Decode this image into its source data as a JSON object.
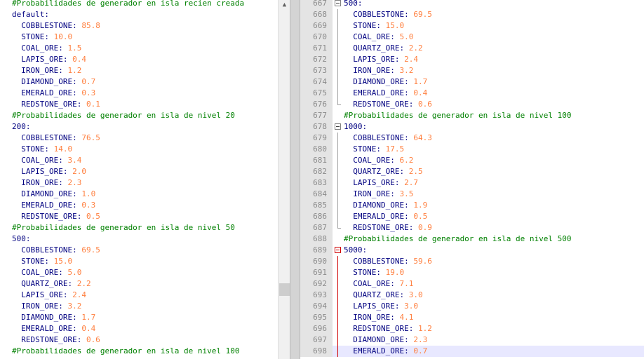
{
  "left_lines": [
    {
      "type": "comment",
      "text": "#Probabilidades de generador en isla recien creada"
    },
    {
      "type": "header",
      "text": "default:"
    },
    {
      "type": "entry",
      "key": "COBBLESTONE",
      "value": "85.8"
    },
    {
      "type": "entry",
      "key": "STONE",
      "value": "10.0"
    },
    {
      "type": "entry",
      "key": "COAL_ORE",
      "value": "1.5"
    },
    {
      "type": "entry",
      "key": "LAPIS_ORE",
      "value": "0.4"
    },
    {
      "type": "entry",
      "key": "IRON_ORE",
      "value": "1.2"
    },
    {
      "type": "entry",
      "key": "DIAMOND_ORE",
      "value": "0.7"
    },
    {
      "type": "entry",
      "key": "EMERALD_ORE",
      "value": "0.3"
    },
    {
      "type": "entry",
      "key": "REDSTONE_ORE",
      "value": "0.1"
    },
    {
      "type": "comment",
      "text": "#Probabilidades de generador en isla de nivel 20"
    },
    {
      "type": "header",
      "text": "200:"
    },
    {
      "type": "entry",
      "key": "COBBLESTONE",
      "value": "76.5"
    },
    {
      "type": "entry",
      "key": "STONE",
      "value": "14.0"
    },
    {
      "type": "entry",
      "key": "COAL_ORE",
      "value": "3.4"
    },
    {
      "type": "entry",
      "key": "LAPIS_ORE",
      "value": "2.0"
    },
    {
      "type": "entry",
      "key": "IRON_ORE",
      "value": "2.3"
    },
    {
      "type": "entry",
      "key": "DIAMOND_ORE",
      "value": "1.0"
    },
    {
      "type": "entry",
      "key": "EMERALD_ORE",
      "value": "0.3"
    },
    {
      "type": "entry",
      "key": "REDSTONE_ORE",
      "value": "0.5"
    },
    {
      "type": "comment",
      "text": "#Probabilidades de generador en isla de nivel 50"
    },
    {
      "type": "header",
      "text": "500:"
    },
    {
      "type": "entry",
      "key": "COBBLESTONE",
      "value": "69.5"
    },
    {
      "type": "entry",
      "key": "STONE",
      "value": "15.0"
    },
    {
      "type": "entry",
      "key": "COAL_ORE",
      "value": "5.0"
    },
    {
      "type": "entry",
      "key": "QUARTZ_ORE",
      "value": "2.2"
    },
    {
      "type": "entry",
      "key": "LAPIS_ORE",
      "value": "2.4"
    },
    {
      "type": "entry",
      "key": "IRON_ORE",
      "value": "3.2"
    },
    {
      "type": "entry",
      "key": "DIAMOND_ORE",
      "value": "1.7"
    },
    {
      "type": "entry",
      "key": "EMERALD_ORE",
      "value": "0.4"
    },
    {
      "type": "entry",
      "key": "REDSTONE_ORE",
      "value": "0.6"
    },
    {
      "type": "comment",
      "text": "#Probabilidades de generador en isla de nivel 100"
    }
  ],
  "right_lines": [
    {
      "ln": "667",
      "type": "header",
      "text": "500:",
      "fold": "open"
    },
    {
      "ln": "668",
      "type": "entry",
      "key": "COBBLESTONE",
      "value": "69.5",
      "fold": "line"
    },
    {
      "ln": "669",
      "type": "entry",
      "key": "STONE",
      "value": "15.0",
      "fold": "line"
    },
    {
      "ln": "670",
      "type": "entry",
      "key": "COAL_ORE",
      "value": "5.0",
      "fold": "line"
    },
    {
      "ln": "671",
      "type": "entry",
      "key": "QUARTZ_ORE",
      "value": "2.2",
      "fold": "line"
    },
    {
      "ln": "672",
      "type": "entry",
      "key": "LAPIS_ORE",
      "value": "2.4",
      "fold": "line"
    },
    {
      "ln": "673",
      "type": "entry",
      "key": "IRON_ORE",
      "value": "3.2",
      "fold": "line"
    },
    {
      "ln": "674",
      "type": "entry",
      "key": "DIAMOND_ORE",
      "value": "1.7",
      "fold": "line"
    },
    {
      "ln": "675",
      "type": "entry",
      "key": "EMERALD_ORE",
      "value": "0.4",
      "fold": "line"
    },
    {
      "ln": "676",
      "type": "entry",
      "key": "REDSTONE_ORE",
      "value": "0.6",
      "fold": "end"
    },
    {
      "ln": "677",
      "type": "comment",
      "text": "#Probabilidades de generador en isla de nivel 100",
      "fold": ""
    },
    {
      "ln": "678",
      "type": "header",
      "text": "1000:",
      "fold": "open"
    },
    {
      "ln": "679",
      "type": "entry",
      "key": "COBBLESTONE",
      "value": "64.3",
      "fold": "line"
    },
    {
      "ln": "680",
      "type": "entry",
      "key": "STONE",
      "value": "17.5",
      "fold": "line"
    },
    {
      "ln": "681",
      "type": "entry",
      "key": "COAL_ORE",
      "value": "6.2",
      "fold": "line"
    },
    {
      "ln": "682",
      "type": "entry",
      "key": "QUARTZ_ORE",
      "value": "2.5",
      "fold": "line"
    },
    {
      "ln": "683",
      "type": "entry",
      "key": "LAPIS_ORE",
      "value": "2.7",
      "fold": "line"
    },
    {
      "ln": "684",
      "type": "entry",
      "key": "IRON_ORE",
      "value": "3.5",
      "fold": "line"
    },
    {
      "ln": "685",
      "type": "entry",
      "key": "DIAMOND_ORE",
      "value": "1.9",
      "fold": "line"
    },
    {
      "ln": "686",
      "type": "entry",
      "key": "EMERALD_ORE",
      "value": "0.5",
      "fold": "line"
    },
    {
      "ln": "687",
      "type": "entry",
      "key": "REDSTONE_ORE",
      "value": "0.9",
      "fold": "end"
    },
    {
      "ln": "688",
      "type": "comment",
      "text": "#Probabilidades de generador en isla de nivel 500",
      "fold": ""
    },
    {
      "ln": "689",
      "type": "header",
      "text": "5000:",
      "fold": "open-red"
    },
    {
      "ln": "690",
      "type": "entry",
      "key": "COBBLESTONE",
      "value": "59.6",
      "fold": "line-red"
    },
    {
      "ln": "691",
      "type": "entry",
      "key": "STONE",
      "value": "19.0",
      "fold": "line-red"
    },
    {
      "ln": "692",
      "type": "entry",
      "key": "COAL_ORE",
      "value": "7.1",
      "fold": "line-red"
    },
    {
      "ln": "693",
      "type": "entry",
      "key": "QUARTZ_ORE",
      "value": "3.0",
      "fold": "line-red"
    },
    {
      "ln": "694",
      "type": "entry",
      "key": "LAPIS_ORE",
      "value": "3.0",
      "fold": "line-red"
    },
    {
      "ln": "695",
      "type": "entry",
      "key": "IRON_ORE",
      "value": "4.1",
      "fold": "line-red"
    },
    {
      "ln": "696",
      "type": "entry",
      "key": "REDSTONE_ORE",
      "value": "1.2",
      "fold": "line-red"
    },
    {
      "ln": "697",
      "type": "entry",
      "key": "DIAMOND_ORE",
      "value": "2.3",
      "fold": "line-red"
    },
    {
      "ln": "698",
      "type": "entry",
      "key": "EMERALD_ORE",
      "value": "0.7",
      "fold": "line-red",
      "current": true
    }
  ],
  "scroll_up_glyph": "▲",
  "colors": {
    "comment": "#008000",
    "key": "#000080",
    "value": "#ff8040",
    "current_line": "#e8e8ff"
  }
}
